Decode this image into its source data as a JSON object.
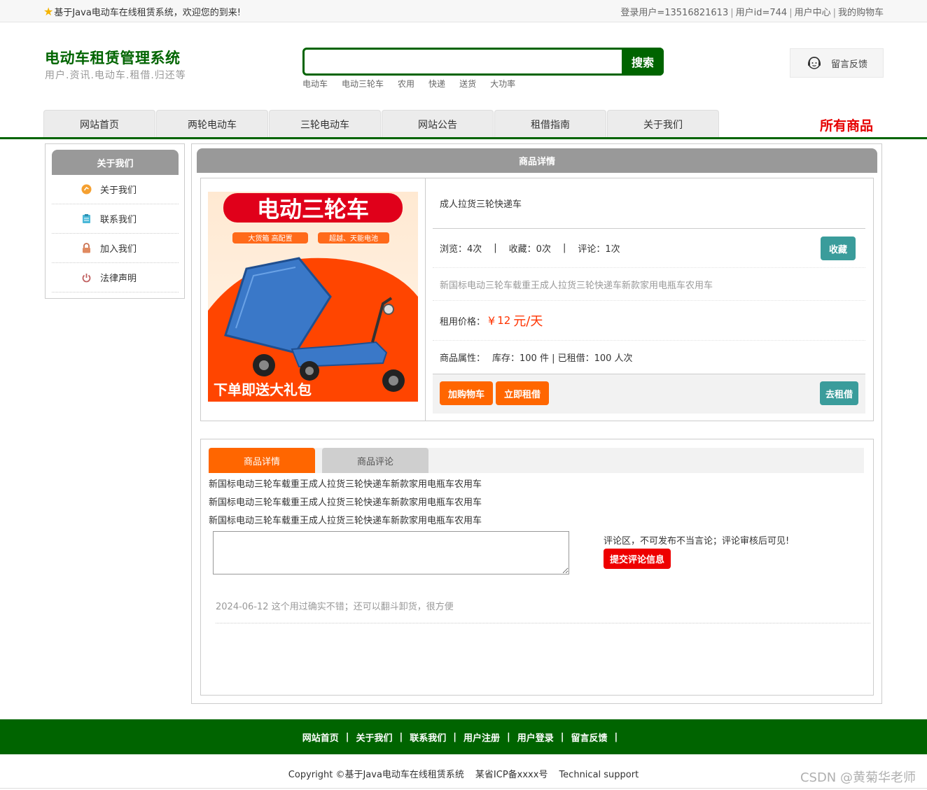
{
  "topbar": {
    "welcome": "基于Java电动车在线租赁系统，欢迎您的到来!",
    "login_user": "登录用户=13516821613",
    "user_id": "用户id=744",
    "user_center": "用户中心",
    "cart": "我的购物车"
  },
  "header": {
    "title": "电动车租赁管理系统",
    "subtitle": "用户.资讯.电动车.租借.归还等",
    "search": {
      "value": "",
      "button": "搜索"
    },
    "hotwords": [
      "电动车",
      "电动三轮车",
      "农用",
      "快递",
      "送货",
      "大功率"
    ],
    "feedback": "留言反馈"
  },
  "nav": {
    "items": [
      "网站首页",
      "两轮电动车",
      "三轮电动车",
      "网站公告",
      "租借指南",
      "关于我们"
    ],
    "all_goods": "所有商品"
  },
  "sidebar": {
    "title": "关于我们",
    "items": [
      {
        "label": "关于我们",
        "icon": "orange-circle-icon"
      },
      {
        "label": "联系我们",
        "icon": "clipboard-icon"
      },
      {
        "label": "加入我们",
        "icon": "lock-icon"
      },
      {
        "label": "法律声明",
        "icon": "power-icon"
      }
    ]
  },
  "product": {
    "section_title": "商品详情",
    "image": {
      "headline": "电动三轮车",
      "tag1": "大货箱 高配置",
      "tag2": "超越、天能电池",
      "bottom": "下单即送大礼包"
    },
    "name": "成人拉货三轮快递车",
    "stats": {
      "views": "浏览：4次",
      "favorites": "收藏：0次",
      "comments": "评论：1次"
    },
    "favorite_button": "收藏",
    "description": "新国标电动三轮车载重王成人拉货三轮快递车新款家用电瓶车农用车",
    "price": {
      "label": "租用价格：",
      "symbol": "¥",
      "value": "12",
      "unit": "元/天"
    },
    "attributes": {
      "label": "商品属性：",
      "text": "库存：100 件 | 已租借：100 人次"
    },
    "buttons": {
      "add_cart": "加购物车",
      "rent_now": "立即租借",
      "go_rent": "去租借"
    }
  },
  "tabs": {
    "items": [
      "商品详情",
      "商品评论"
    ],
    "active": 0,
    "detail_lines": [
      "新国标电动三轮车载重王成人拉货三轮快递车新款家用电瓶车农用车",
      "新国标电动三轮车载重王成人拉货三轮快递车新款家用电瓶车农用车",
      "新国标电动三轮车载重王成人拉货三轮快递车新款家用电瓶车农用车"
    ],
    "comment_placeholder": "",
    "comment_note": "评论区，不可发布不当言论；评论审核后可见!",
    "submit_button": "提交评论信息",
    "comments": [
      {
        "date": "2024-06-12",
        "text": "这个用过确实不错；还可以翻斗卸货，很方便"
      }
    ]
  },
  "footer": {
    "links": [
      "网站首页",
      "关于我们",
      "联系我们",
      "用户注册",
      "用户登录",
      "留言反馈"
    ],
    "copyright": "Copyright ©基于Java电动车在线租赁系统",
    "icp": "某省ICP备xxxx号",
    "support": "Technical support",
    "watermark": "CSDN @黄菊华老师"
  },
  "colors": {
    "brand_green": "#006400",
    "accent_orange": "#ff6600",
    "teal": "#3a9c9b",
    "price_red": "#ff3300",
    "alert_red": "#ee0000"
  }
}
